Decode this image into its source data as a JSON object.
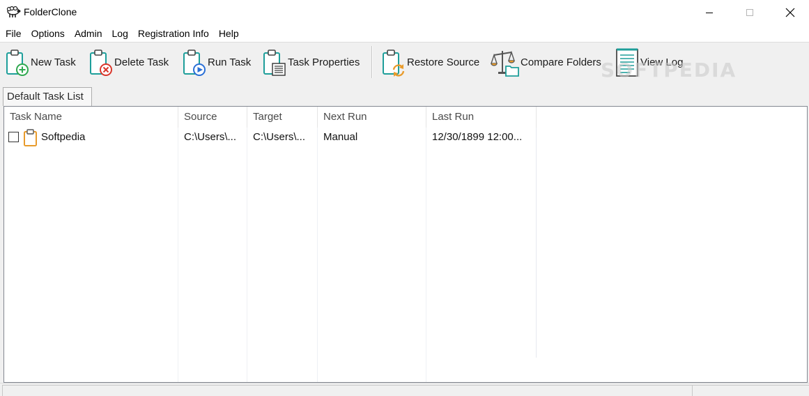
{
  "window": {
    "title": "FolderClone",
    "icon": "sheep-icon"
  },
  "menu": [
    "File",
    "Options",
    "Admin",
    "Log",
    "Registration Info",
    "Help"
  ],
  "toolbar": {
    "new_task": "New Task",
    "delete_task": "Delete Task",
    "run_task": "Run Task",
    "task_properties": "Task Properties",
    "restore_source": "Restore Source",
    "compare_folders": "Compare Folders",
    "view_log": "View Log"
  },
  "watermark": "SOFTPEDIA",
  "tabs": [
    {
      "label": "Default Task List"
    }
  ],
  "table": {
    "columns": [
      "Task Name",
      "Source",
      "Target",
      "Next Run",
      "Last Run"
    ],
    "rows": [
      {
        "checked": false,
        "task_name": "Softpedia",
        "source": "C:\\Users\\...",
        "target": "C:\\Users\\...",
        "next_run": "Manual",
        "last_run": "12/30/1899 12:00..."
      }
    ]
  },
  "colors": {
    "accent_teal": "#1e9e9a",
    "clipboard_orange": "#e89b2c",
    "add_green": "#2fa84f",
    "delete_red": "#d9362b",
    "run_blue": "#2a6fd6"
  }
}
